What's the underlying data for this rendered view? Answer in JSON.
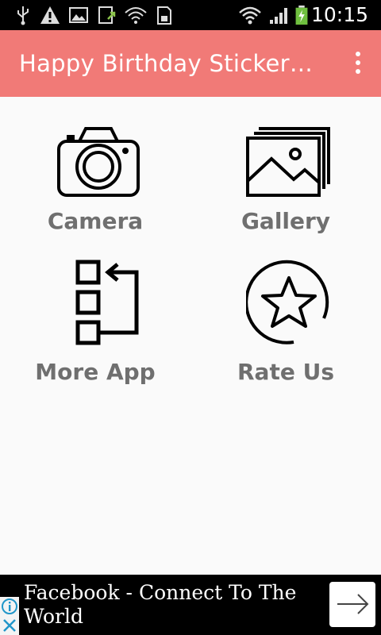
{
  "status_bar": {
    "time": "10:15",
    "icons": [
      "usb-icon",
      "warning-icon",
      "image-icon",
      "download-icon",
      "wifi-lock-icon",
      "sd-card-icon",
      "wifi-icon",
      "signal-icon",
      "battery-charging-icon"
    ]
  },
  "app_bar": {
    "title": "Happy Birthday Stickers P...",
    "color": "#f17a77"
  },
  "menu": [
    {
      "label": "Camera",
      "icon": "camera-icon"
    },
    {
      "label": "Gallery",
      "icon": "gallery-icon"
    },
    {
      "label": "More App",
      "icon": "more-apps-icon"
    },
    {
      "label": "Rate Us",
      "icon": "star-icon"
    }
  ],
  "ad": {
    "text": "Facebook - Connect To The World",
    "info_icon": "info-icon",
    "close_icon": "close-icon",
    "arrow_icon": "arrow-right-icon"
  }
}
